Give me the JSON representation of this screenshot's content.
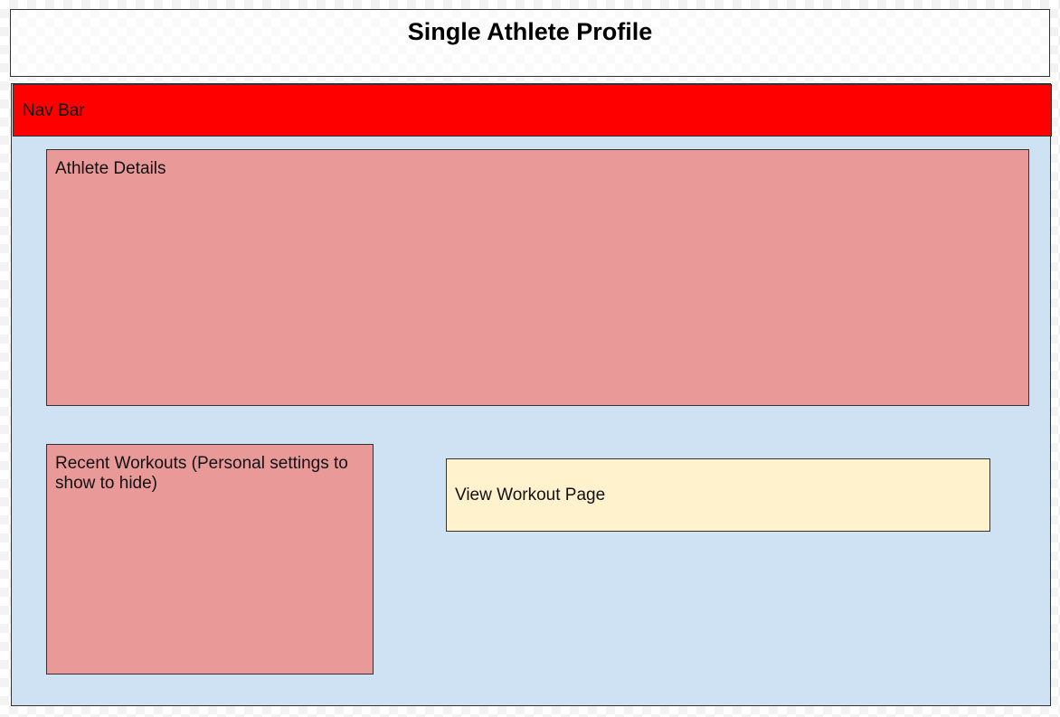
{
  "title": "Single Athlete Profile",
  "nav_bar": {
    "label": "Nav Bar"
  },
  "athlete_details": {
    "label": "Athlete Details"
  },
  "recent_workouts": {
    "label": "Recent Workouts (Personal settings to show to hide)"
  },
  "view_workout": {
    "label": "View Workout Page"
  },
  "colors": {
    "canvas": "#cfe2f3",
    "nav_bar": "#ff0000",
    "section": "#ea9999",
    "link_box": "#fff2cc"
  }
}
